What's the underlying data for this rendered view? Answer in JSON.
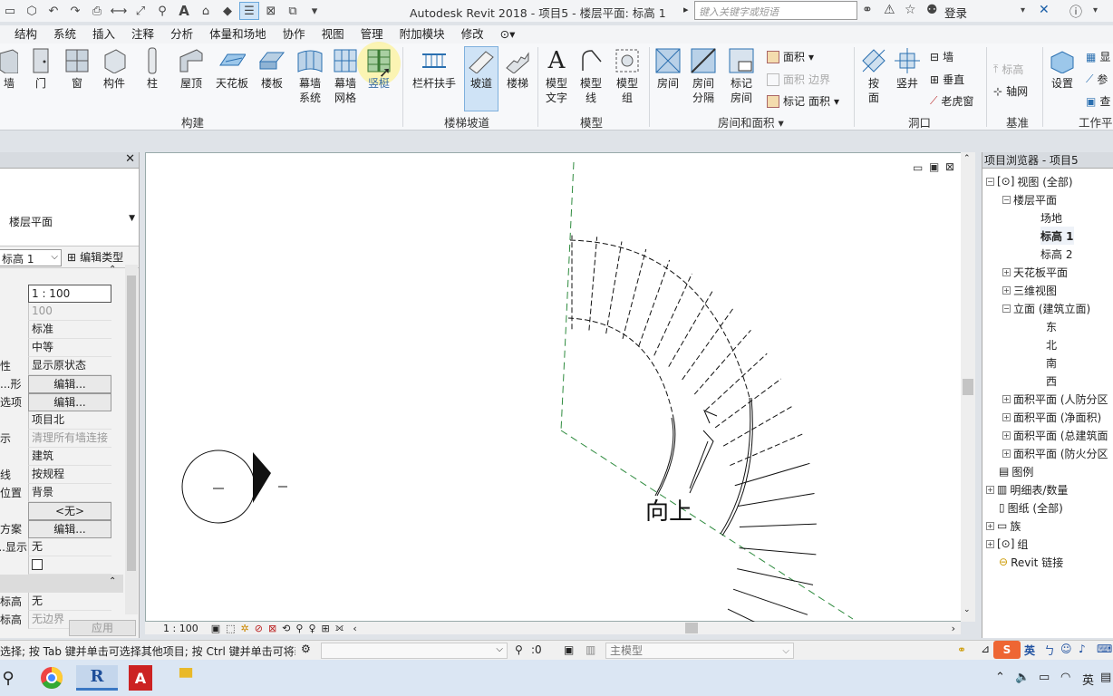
{
  "titlebar": {
    "app_title": "Autodesk Revit 2018 -     项目5 - 楼层平面: 标高 1",
    "search_placeholder": "键入关键字或短语",
    "login_label": "登录",
    "quick_access_icons": [
      "open-icon",
      "save-icon",
      "undo-icon",
      "redo-icon",
      "print-icon",
      "measure-icon",
      "dimension-icon",
      "tag-icon",
      "text-icon",
      "3d-view-icon",
      "section-icon",
      "thin-lines-icon",
      "close-inactive-icon",
      "switch-windows-icon"
    ]
  },
  "tabs": [
    "结构",
    "系统",
    "插入",
    "注释",
    "分析",
    "体量和场地",
    "协作",
    "视图",
    "管理",
    "附加模块",
    "修改"
  ],
  "ribbon": {
    "build": {
      "wall": "墙",
      "door": "门",
      "window": "窗",
      "component": "构件",
      "column": "柱",
      "roof": "屋顶",
      "ceiling": "天花板",
      "floor": "楼板",
      "curtain_system_1": "幕墙",
      "curtain_system_2": "系统",
      "curtain_grid_1": "幕墙",
      "curtain_grid_2": "网格",
      "mullion": "竖梃",
      "title": "构建"
    },
    "circulation": {
      "railing": "栏杆扶手",
      "ramp": "坡道",
      "stair": "楼梯",
      "title": "楼梯坡道"
    },
    "model": {
      "model_text_1": "模型",
      "model_text_2": "文字",
      "model_line_1": "模型",
      "model_line_2": "线",
      "model_group_1": "模型",
      "model_group_2": "组",
      "title": "模型"
    },
    "room_area": {
      "room": "房间",
      "room_sep_1": "房间",
      "room_sep_2": "分隔",
      "tag_room_1": "标记",
      "tag_room_2": "房间",
      "area": "面积",
      "area_boundary_1": "面积",
      "area_boundary_2": "边界",
      "tag_area_1": "标记",
      "tag_area_2": "面积",
      "title": "房间和面积"
    },
    "opening": {
      "by_face_1": "按",
      "by_face_2": "面",
      "shaft": "竖井",
      "wall": "墙",
      "vertical": "垂直",
      "dormer": "老虎窗",
      "title": "洞口"
    },
    "datum": {
      "level": "标高",
      "grid": "轴网",
      "title": "基准"
    },
    "workplane": {
      "set": "设置",
      "show": "显",
      "ref": "参",
      "viewer": "查",
      "title": "工作平"
    }
  },
  "properties": {
    "type_name": "楼层平面",
    "instance_value": "标高 1",
    "edit_type": "编辑类型",
    "rows": [
      {
        "key": "",
        "value": "1 : 100",
        "style": "box"
      },
      {
        "key": "",
        "value": "100",
        "style": "gray"
      },
      {
        "key": "",
        "value": "标准",
        "style": ""
      },
      {
        "key": "",
        "value": "中等",
        "style": ""
      },
      {
        "key": "性",
        "value": "显示原状态",
        "style": ""
      },
      {
        "key": "形...",
        "value": "编辑...",
        "style": "btn"
      },
      {
        "key": "选项",
        "value": "编辑...",
        "style": "btn"
      },
      {
        "key": "",
        "value": "项目北",
        "style": ""
      },
      {
        "key": "示",
        "value": "清理所有墙连接",
        "style": "gray"
      },
      {
        "key": "",
        "value": "建筑",
        "style": ""
      },
      {
        "key": "线",
        "value": "按规程",
        "style": ""
      },
      {
        "key": "位置",
        "value": "背景",
        "style": ""
      },
      {
        "key": "",
        "value": "<无>",
        "style": "btn"
      },
      {
        "key": "方案",
        "value": "编辑...",
        "style": "btn"
      },
      {
        "key": "显示...",
        "value": "无",
        "style": ""
      },
      {
        "key": "",
        "value": "",
        "style": "check"
      },
      {
        "key": "",
        "value": "",
        "style": "section"
      },
      {
        "key": "标高",
        "value": "无",
        "style": ""
      },
      {
        "key": "标高",
        "value": "无边界",
        "style": "gray"
      }
    ],
    "apply_label": "应用"
  },
  "canvas": {
    "stair_label": "向上",
    "scale_label": "1 : 100"
  },
  "browser": {
    "title": "项目浏览器 - 项目5",
    "nodes": {
      "views_all": "视图 (全部)",
      "floor_plans": "楼层平面",
      "site": "场地",
      "level1": "标高 1",
      "level2": "标高 2",
      "ceiling_plans": "天花板平面",
      "views_3d": "三维视图",
      "elevations": "立面 (建筑立面)",
      "east": "东",
      "north": "北",
      "south": "南",
      "west": "西",
      "area_plan_1": "面积平面 (人防分区",
      "area_plan_2": "面积平面 (净面积)",
      "area_plan_3": "面积平面 (总建筑面",
      "area_plan_4": "面积平面 (防火分区",
      "legends": "图例",
      "schedules": "明细表/数量",
      "sheets": "图纸 (全部)",
      "families": "族",
      "groups": "组",
      "revit_links": "Revit 链接"
    }
  },
  "status": {
    "text": "选择; 按 Tab 键并单击可选择其他项目; 按 Ctrl 键并单击可将新",
    "zero": ":0",
    "main_model": "主模型"
  },
  "colors": {
    "accent": "#0078d7",
    "active_tool": "#cfe3f6",
    "dashed_line": "#2e8b3e"
  }
}
